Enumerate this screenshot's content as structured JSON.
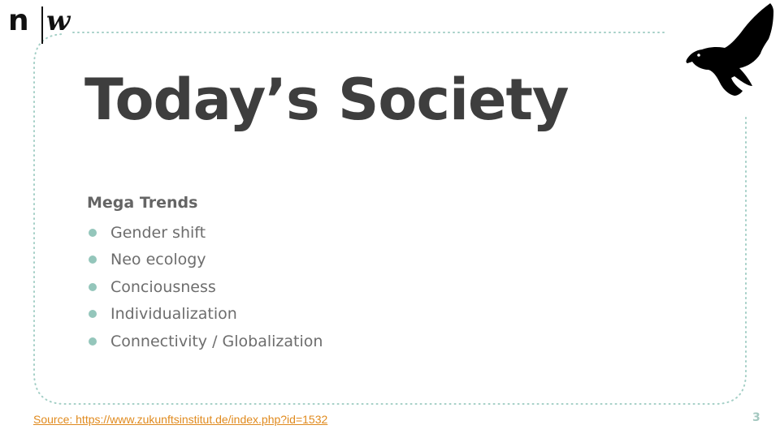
{
  "logo": {
    "left": "n",
    "right": "w"
  },
  "slide": {
    "title": "Today’s Society",
    "subtitle": "Mega Trends",
    "items": [
      "Gender shift",
      "Neo ecology",
      "Conciousness",
      "Individualization",
      "Connectivity / Globalization"
    ],
    "source": "Source: https://www.zukunftsinstitut.de/index.php?id=1532",
    "page_number": "3"
  },
  "colors": {
    "title": "#3e3e3e",
    "text": "#6d6d6d",
    "bullet": "#94c6bb",
    "frame": "#a4cfc6",
    "link": "#e08a1e"
  },
  "icons": {
    "brand_mark": "bird-icon"
  }
}
